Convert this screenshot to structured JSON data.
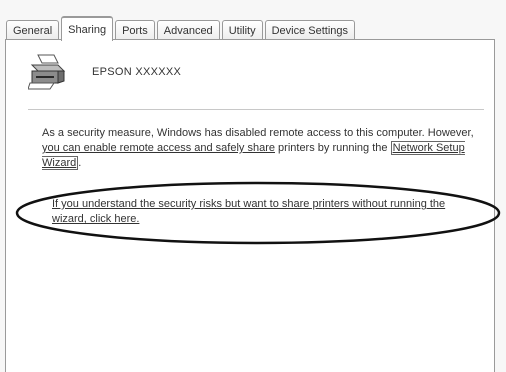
{
  "tabs": [
    {
      "label": "General",
      "active": false
    },
    {
      "label": "Sharing",
      "active": true
    },
    {
      "label": "Ports",
      "active": false
    },
    {
      "label": "Advanced",
      "active": false
    },
    {
      "label": "Utility",
      "active": false
    },
    {
      "label": "Device Settings",
      "active": false
    }
  ],
  "printer": {
    "name": "EPSON XXXXXX",
    "icon": "printer-icon"
  },
  "message": {
    "part1": "As a security measure, Windows has disabled remote access to this computer. However, ",
    "link1": "you can enable remote access and safely share",
    "part2": " printers by running the ",
    "link2": "Network Setup Wizard",
    "part3": "."
  },
  "share_link": "If you understand the security risks but want to share printers without running the wizard, click here."
}
